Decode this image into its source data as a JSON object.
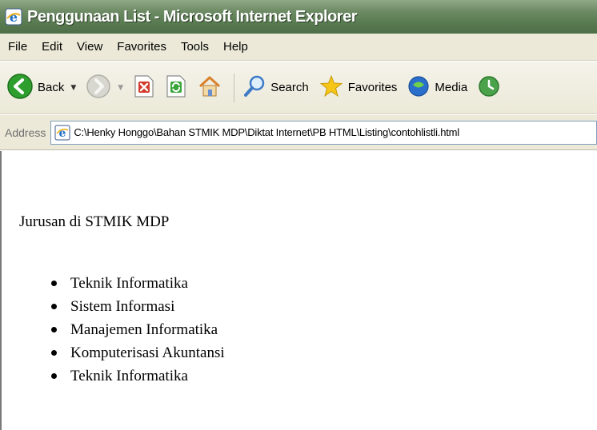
{
  "window": {
    "title": "Penggunaan List - Microsoft Internet Explorer"
  },
  "menu": [
    "File",
    "Edit",
    "View",
    "Favorites",
    "Tools",
    "Help"
  ],
  "toolbar": {
    "back_label": "Back",
    "search_label": "Search",
    "favorites_label": "Favorites",
    "media_label": "Media"
  },
  "address": {
    "label": "Address",
    "url": "C:\\Henky Honggo\\Bahan STMIK MDP\\Diktat Internet\\PB HTML\\Listing\\contohlistli.html"
  },
  "content": {
    "heading": "Jurusan di STMIK MDP",
    "items": [
      "Teknik Informatika",
      "Sistem Informasi",
      "Manajemen Informatika",
      "Komputerisasi Akuntansi",
      "Teknik Informatika"
    ]
  },
  "colors": {
    "titlebar": "#587a50",
    "chrome": "#ece9d8",
    "back_green": "#2e9e2e",
    "stop_red": "#d23a2a"
  }
}
